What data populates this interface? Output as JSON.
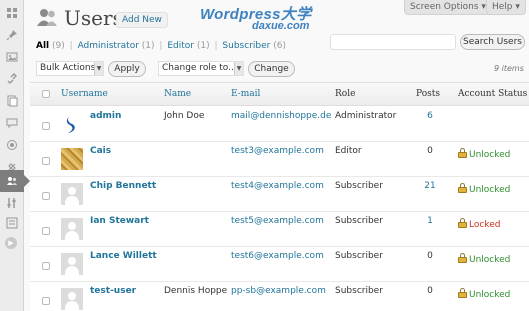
{
  "page": {
    "title": "Users",
    "add_new_label": "Add New",
    "watermark_line1": "Wordpress大学",
    "watermark_line2": "daxue.com"
  },
  "screen_meta": {
    "screen_options_label": "Screen Options ▾",
    "help_label": "Help ▾"
  },
  "filters": [
    {
      "label": "All",
      "count": "(9)",
      "current": true
    },
    {
      "label": "Administrator",
      "count": "(1)"
    },
    {
      "label": "Editor",
      "count": "(1)"
    },
    {
      "label": "Subscriber",
      "count": "(6)"
    }
  ],
  "filter_separator": "|",
  "search": {
    "value": "",
    "button_label": "Search Users"
  },
  "tablenav": {
    "bulk_actions_value": "Bulk Actions",
    "apply_label": "Apply",
    "change_role_value": "Change role to...",
    "change_label": "Change",
    "items_count": "9 items"
  },
  "table": {
    "columns": {
      "username": "Username",
      "name": "Name",
      "email": "E-mail",
      "role": "Role",
      "posts": "Posts",
      "status": "Account Status"
    },
    "rows": [
      {
        "username": "admin",
        "name": "John Doe",
        "email": "mail@dennishoppe.de",
        "role": "Administrator",
        "posts": "6",
        "posts_linked": true,
        "status": "",
        "status_state": "none",
        "avatar": "brand"
      },
      {
        "username": "Cais",
        "name": "",
        "email": "test3@example.com",
        "role": "Editor",
        "posts": "0",
        "posts_linked": false,
        "status": "Unlocked",
        "status_state": "unlocked",
        "avatar": "photo"
      },
      {
        "username": "Chip Bennett",
        "name": "",
        "email": "test4@example.com",
        "role": "Subscriber",
        "posts": "21",
        "posts_linked": true,
        "status": "Unlocked",
        "status_state": "unlocked",
        "avatar": "mystery"
      },
      {
        "username": "Ian Stewart",
        "name": "",
        "email": "test5@example.com",
        "role": "Subscriber",
        "posts": "1",
        "posts_linked": true,
        "status": "Locked",
        "status_state": "locked",
        "avatar": "mystery"
      },
      {
        "username": "Lance Willett",
        "name": "",
        "email": "test6@example.com",
        "role": "Subscriber",
        "posts": "0",
        "posts_linked": false,
        "status": "Unlocked",
        "status_state": "unlocked",
        "avatar": "mystery"
      },
      {
        "username": "test-user",
        "name": "Dennis Hoppe",
        "email": "pp-sb@example.com",
        "role": "Subscriber",
        "posts": "0",
        "posts_linked": false,
        "status": "Unlocked",
        "status_state": "unlocked",
        "avatar": "mystery"
      }
    ]
  },
  "colors": {
    "link": "#21759b",
    "unlocked": "#2f8f2f",
    "locked": "#d0301f",
    "menu_current": "#7d7d7d"
  },
  "menu_icons": [
    "dashboard-icon",
    "pin-icon",
    "media-icon",
    "links-icon",
    "pages-icon",
    "comments-icon",
    "appearance-icon",
    "plugins-icon",
    "users-icon",
    "tools-icon",
    "settings-icon",
    "collapse-icon"
  ]
}
